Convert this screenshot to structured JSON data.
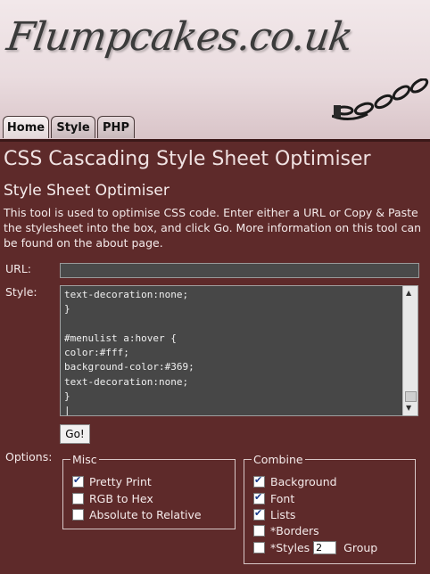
{
  "header": {
    "logo_text": "Flumpcakes.co.uk",
    "tabs": [
      {
        "label": "Home",
        "active": true
      },
      {
        "label": "Style",
        "active": false
      },
      {
        "label": "PHP",
        "active": false
      }
    ]
  },
  "page": {
    "title": "CSS Cascading Style Sheet Optimiser",
    "subtitle": "Style Sheet Optimiser",
    "description": "This tool is used to optimise CSS code. Enter either a URL or Copy & Paste the stylesheet into the box, and click Go. More information on this tool can be found on the about page."
  },
  "form": {
    "url_label": "URL:",
    "url_value": "",
    "style_label": "Style:",
    "style_value": "text-decoration:none;\n}\n\n#menulist a:hover {\ncolor:#fff;\nbackground-color:#369;\ntext-decoration:none;\n}\n|",
    "go_label": "Go!",
    "options_label": "Options:"
  },
  "misc": {
    "legend": "Misc",
    "items": [
      {
        "label": "Pretty Print",
        "checked": true
      },
      {
        "label": "RGB to Hex",
        "checked": false
      },
      {
        "label": "Absolute to Relative",
        "checked": false
      }
    ]
  },
  "combine": {
    "legend": "Combine",
    "items": [
      {
        "label": "Background",
        "checked": true
      },
      {
        "label": "Font",
        "checked": true
      },
      {
        "label": "Lists",
        "checked": true
      },
      {
        "label": "*Borders",
        "checked": false
      },
      {
        "label": "*Styles",
        "checked": false
      }
    ],
    "styles_group_value": "2",
    "styles_group_suffix": "Group"
  },
  "colors": {
    "page_bg": "#5e2a2a",
    "header_bg": "#eadcdf",
    "input_bg": "#474747"
  }
}
